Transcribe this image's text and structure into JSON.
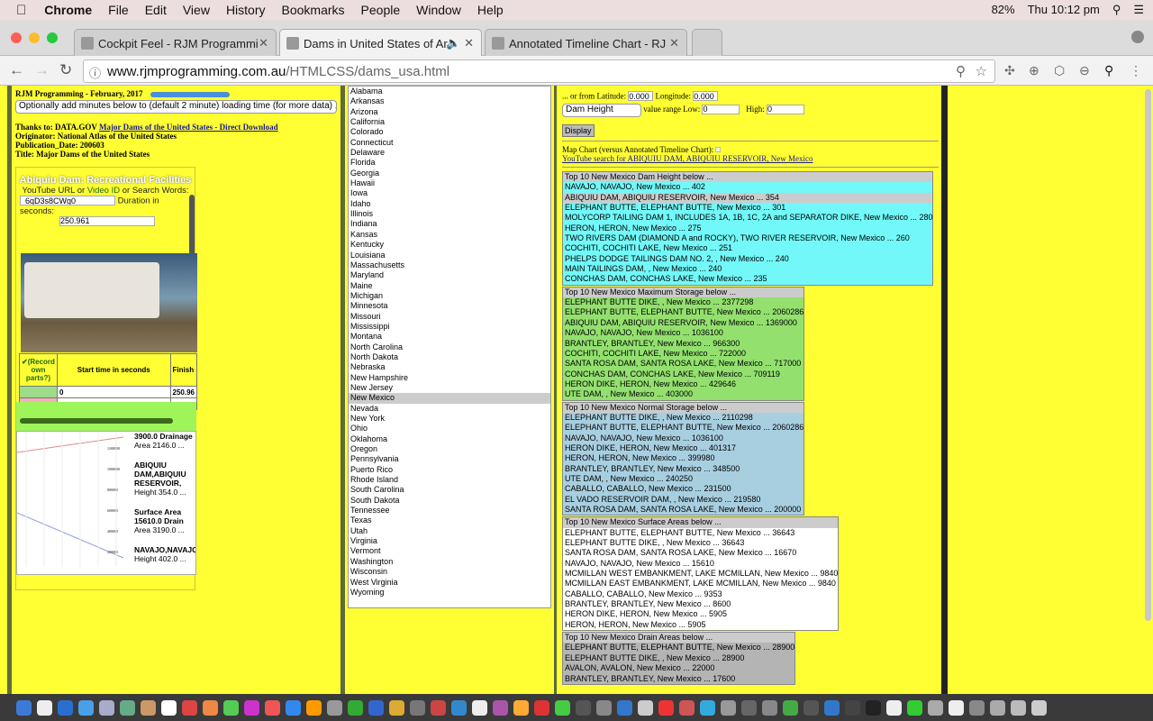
{
  "menubar": {
    "app": "Chrome",
    "items": [
      "File",
      "Edit",
      "View",
      "History",
      "Bookmarks",
      "People",
      "Window",
      "Help"
    ],
    "battery": "82%",
    "clock": "Thu 10:12 pm"
  },
  "tabs": [
    {
      "title": "Cockpit Feel - RJM Programmi"
    },
    {
      "title": "Dams in United States of Ar"
    },
    {
      "title": "Annotated Timeline Chart - RJ"
    }
  ],
  "address": {
    "host": "www.rjmprogramming.com.au",
    "path": "/HTMLCSS/dams_usa.html"
  },
  "left": {
    "heading": "RJM Programming - February, 2017",
    "minutes_select": "Optionally add minutes below to (default 2 minute) loading time (for more data) ...",
    "thanks_prefix": "Thanks to: DATA.GOV",
    "thanks_link": "Major Dams of the United States - Direct Download",
    "originator": "Originator: National Atlas of the United States",
    "pubdate": "Publication_Date: 200603",
    "title": "Title: Major Dams of the United States",
    "video_title": "Abiquiu Dam: Recreational Facilities",
    "yt_label_1": "YouTube URL or ",
    "yt_label_link": "Video ID",
    "yt_label_2": " or Search Words:",
    "video_id": "_6qD3s8CWg0",
    "duration_label": "Duration in seconds:",
    "duration": "250.961",
    "table": {
      "h1": "✔(Record own parts?)",
      "h2": "Start time in seconds",
      "h3": "Finish",
      "r1_start": "0",
      "r1_finish": "250.96"
    },
    "annotations": [
      "3900.0 Drainage",
      "Area 2146.0 ...",
      "ABIQUIU",
      "DAM,ABIQUIU",
      "RESERVOIR,",
      "Height 354.0 ...",
      "Surface Area",
      "15610.0 Drain",
      "Area 3190.0 ...",
      "NAVAJO,NAVAJO",
      "Height 402.0 ..."
    ],
    "annotation_flags": [
      "C",
      "B",
      "A"
    ]
  },
  "states": {
    "items": [
      "Alabama",
      "Arkansas",
      "Arizona",
      "California",
      "Colorado",
      "Connecticut",
      "Delaware",
      "Florida",
      "Georgia",
      "Hawaii",
      "Iowa",
      "Idaho",
      "Illinois",
      "Indiana",
      "Kansas",
      "Kentucky",
      "Louisiana",
      "Massachusetts",
      "Maryland",
      "Maine",
      "Michigan",
      "Minnesota",
      "Missouri",
      "Mississippi",
      "Montana",
      "North Carolina",
      "North Dakota",
      "Nebraska",
      "New Hampshire",
      "New Jersey",
      "New Mexico",
      "Nevada",
      "New York",
      "Ohio",
      "Oklahoma",
      "Oregon",
      "Pennsylvania",
      "Puerto Rico",
      "Rhode Island",
      "South Carolina",
      "South Dakota",
      "Tennessee",
      "Texas",
      "Utah",
      "Virginia",
      "Vermont",
      "Washington",
      "Wisconsin",
      "West Virginia",
      "Wyoming"
    ],
    "selected": "New Mexico"
  },
  "right": {
    "lat_label": "... or from Latitude:",
    "lat": "0.000",
    "lon_label": "Longitude:",
    "lon": "0.000",
    "measure": "Dam Height",
    "low_label": "value range Low:",
    "low": "0",
    "high_label": "High:",
    "high": "0",
    "display": "Display",
    "map_label": "Map Chart (versus Annotated Timeline Chart):",
    "yt_search": "YouTube search for ABIQUIU DAM, ABIQUIU RESERVOIR, New Mexico",
    "lists": [
      {
        "header": "Top 10 New Mexico Dam Height below ...",
        "color": "#72f8f8",
        "selected": 1,
        "items": [
          "NAVAJO, NAVAJO, New Mexico ... 402",
          "ABIQUIU DAM, ABIQUIU RESERVOIR, New Mexico ... 354",
          "ELEPHANT BUTTE, ELEPHANT BUTTE, New Mexico ... 301",
          "MOLYCORP TAILING DAM 1, INCLUDES 1A, 1B, 1C, 2A and SEPARATOR DIKE, New Mexico ... 280",
          "HERON, HERON, New Mexico ... 275",
          "TWO RIVERS DAM (DIAMOND A and ROCKY), TWO RIVER RESERVOIR, New Mexico ... 260",
          "COCHITI, COCHITI LAKE, New Mexico ... 251",
          "PHELPS DODGE TAILINGS DAM NO. 2,   , New Mexico ... 240",
          "MAIN TAILINGS DAM,   , New Mexico ... 240",
          "CONCHAS DAM, CONCHAS LAKE, New Mexico ... 235"
        ]
      },
      {
        "header": "Top 10 New Mexico Maximum Storage below ...",
        "color": "#93e06f",
        "items": [
          "ELEPHANT BUTTE DIKE,   , New Mexico ... 2377298",
          "ELEPHANT BUTTE, ELEPHANT BUTTE, New Mexico ... 2060286",
          "ABIQUIU DAM, ABIQUIU RESERVOIR, New Mexico ... 1369000",
          "NAVAJO, NAVAJO, New Mexico ... 1036100",
          "BRANTLEY, BRANTLEY, New Mexico ... 966300",
          "COCHITI, COCHITI LAKE, New Mexico ... 722000",
          "SANTA ROSA DAM, SANTA ROSA LAKE, New Mexico ... 717000",
          "CONCHAS DAM, CONCHAS LAKE, New Mexico ... 709119",
          "HERON DIKE, HERON, New Mexico ... 429646",
          "UTE DAM,   , New Mexico ... 403000"
        ]
      },
      {
        "header": "Top 10 New Mexico Normal Storage below ...",
        "color": "#a8cfe0",
        "items": [
          "ELEPHANT BUTTE DIKE,   , New Mexico ... 2110298",
          "ELEPHANT BUTTE, ELEPHANT BUTTE, New Mexico ... 2060286",
          "NAVAJO, NAVAJO, New Mexico ... 1036100",
          "HERON DIKE, HERON, New Mexico ... 401317",
          "HERON, HERON, New Mexico ... 399980",
          "BRANTLEY, BRANTLEY, New Mexico ... 348500",
          "UTE DAM,   , New Mexico ... 240250",
          "CABALLO, CABALLO, New Mexico ... 231500",
          "EL VADO RESERVOIR DAM,   , New Mexico ... 219580",
          "SANTA ROSA DAM, SANTA ROSA LAKE, New Mexico ... 200000"
        ]
      },
      {
        "header": "Top 10 New Mexico Surface Areas below ...",
        "color": "#ffffff",
        "items": [
          "ELEPHANT BUTTE, ELEPHANT BUTTE, New Mexico ... 36643",
          "ELEPHANT BUTTE DIKE,   , New Mexico ... 36643",
          "SANTA ROSA DAM, SANTA ROSA LAKE, New Mexico ... 16670",
          "NAVAJO, NAVAJO, New Mexico ... 15610",
          "MCMILLAN WEST EMBANKMENT, LAKE MCMILLAN, New Mexico ... 9840",
          "MCMILLAN EAST EMBANKMENT, LAKE MCMILLAN, New Mexico ... 9840",
          "CABALLO, CABALLO, New Mexico ... 9353",
          "BRANTLEY, BRANTLEY, New Mexico ... 8600",
          "HERON DIKE, HERON, New Mexico ... 5905",
          "HERON, HERON, New Mexico ... 5905"
        ]
      },
      {
        "header": "Top 10 New Mexico Drain Areas below ...",
        "color": "#b4b4b4",
        "items": [
          "ELEPHANT BUTTE, ELEPHANT BUTTE, New Mexico ... 28900",
          "ELEPHANT BUTTE DIKE,   , New Mexico ... 28900",
          "AVALON, AVALON, New Mexico ... 22000",
          "BRANTLEY, BRANTLEY, New Mexico ... 17600"
        ]
      }
    ]
  },
  "chart_ticks": [
    "1200000",
    "1000000",
    "800000",
    "600000",
    "400000",
    "200000"
  ]
}
